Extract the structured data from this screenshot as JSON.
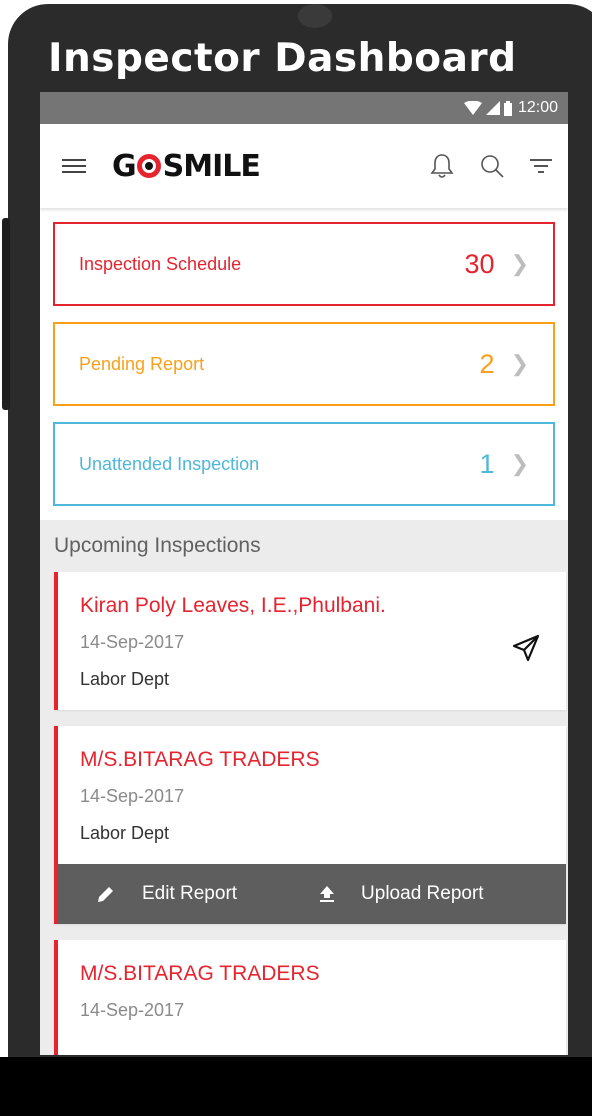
{
  "page_heading": "Inspector Dashboard",
  "status_bar": {
    "time": "12:00"
  },
  "app_bar": {
    "logo_text_left": "G",
    "logo_text_right": "SMILE",
    "icons": [
      "menu-icon",
      "bell-icon",
      "search-icon",
      "filter-icon"
    ]
  },
  "summary": [
    {
      "label": "Inspection Schedule",
      "count": "30",
      "color": "#e5242f"
    },
    {
      "label": "Pending Report",
      "count": "2",
      "color": "#f9a01b"
    },
    {
      "label": "Unattended Inspection",
      "count": "1",
      "color": "#4fb8d9"
    }
  ],
  "upcoming": {
    "title": "Upcoming Inspections",
    "items": [
      {
        "name": "Kiran Poly Leaves, I.E.,Phulbani.",
        "date": "14-Sep-2017",
        "dept": "Labor Dept"
      },
      {
        "name": "M/S.BITARAG TRADERS",
        "date": "14-Sep-2017",
        "dept": "Labor Dept",
        "actions": {
          "edit": "Edit Report",
          "upload": "Upload Report"
        }
      },
      {
        "name": "M/S.BITARAG TRADERS",
        "date": "14-Sep-2017"
      }
    ]
  },
  "colors": {
    "accent": "#e5242f",
    "status_bar": "#757575",
    "action_bar": "#5e5e5e"
  }
}
